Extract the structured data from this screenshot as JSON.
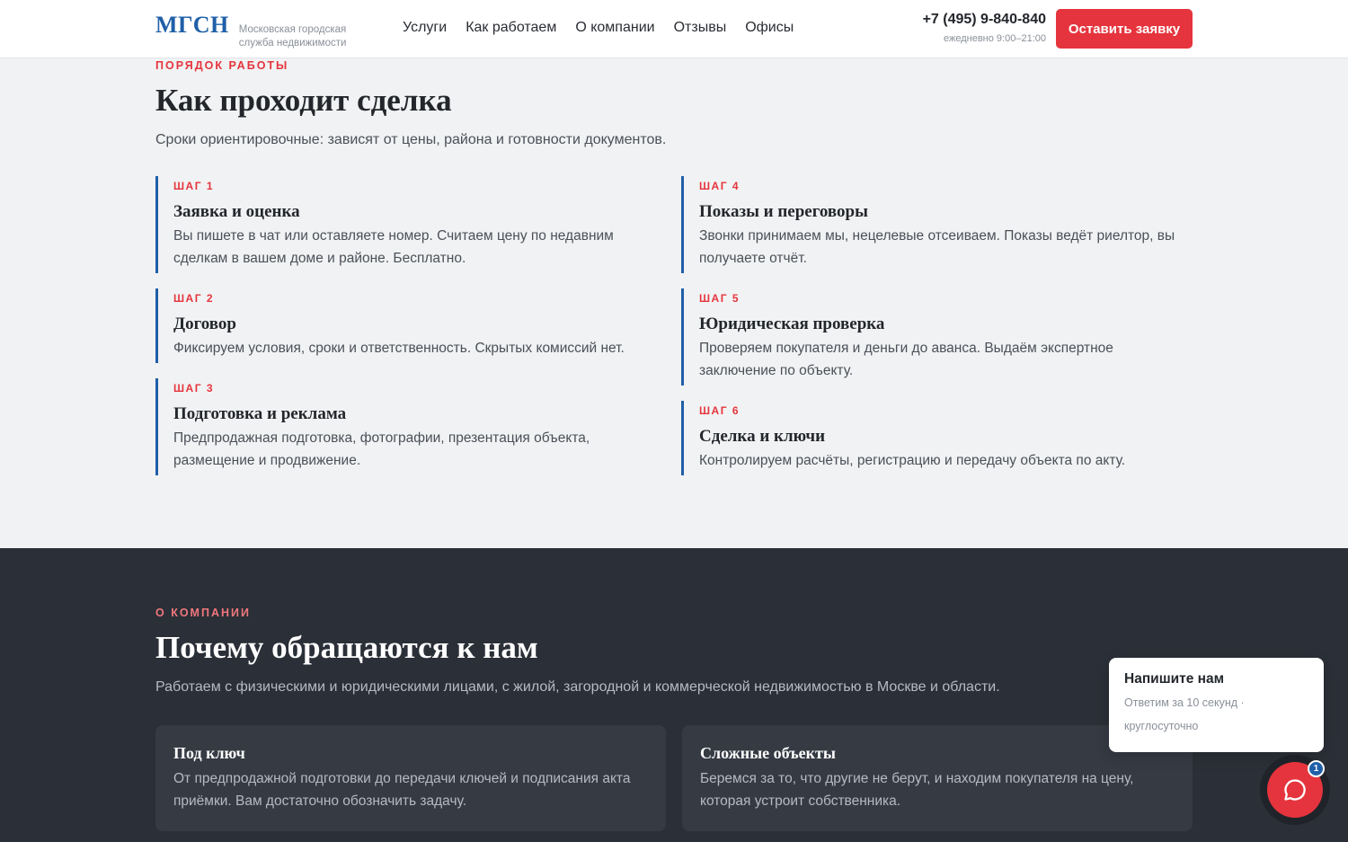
{
  "header": {
    "logo": "МГСН",
    "logo_sub": "Московская городская служба недвижимости",
    "nav": [
      "Услуги",
      "Как работаем",
      "О компании",
      "Отзывы",
      "Офисы"
    ],
    "phone": "+7 (495) 9-840-840",
    "hours": "ежедневно 9:00–21:00",
    "cta_label": "Оставить заявку"
  },
  "steps_section": {
    "eyebrow": "ПОРЯДОК РАБОТЫ",
    "title": "Как проходит сделка",
    "lead": "Сроки ориентировочные: зависят от цены, района и готовности документов.",
    "steps": [
      {
        "num": "ШАГ 1",
        "title": "Заявка и оценка",
        "text": "Вы пишете в чат или оставляете номер. Считаем цену по недавним сделкам в вашем доме и районе. Бесплатно."
      },
      {
        "num": "ШАГ 2",
        "title": "Договор",
        "text": "Фиксируем условия, сроки и ответственность. Скрытых комиссий нет."
      },
      {
        "num": "ШАГ 3",
        "title": "Подготовка и реклама",
        "text": "Предпродажная подготовка, фотографии, презентация объекта, размещение и продвижение."
      },
      {
        "num": "ШАГ 4",
        "title": "Показы и переговоры",
        "text": "Звонки принимаем мы, нецелевые отсеиваем. Показы ведёт риелтор, вы получаете отчёт."
      },
      {
        "num": "ШАГ 5",
        "title": "Юридическая проверка",
        "text": "Проверяем покупателя и деньги до аванса. Выдаём экспертное заключение по объекту."
      },
      {
        "num": "ШАГ 6",
        "title": "Сделка и ключи",
        "text": "Контролируем расчёты, регистрацию и передачу объекта по акту."
      }
    ]
  },
  "about_section": {
    "eyebrow": "О КОМПАНИИ",
    "title": "Почему обращаются к нам",
    "lead": "Работаем с физическими и юридическими лицами, с жилой, загородной и коммерческой недвижимостью в Москве и области.",
    "cards": [
      {
        "title": "Под ключ",
        "text": "От предпродажной подготовки до передачи ключей и подписания акта приёмки. Вам достаточно обозначить задачу."
      },
      {
        "title": "Сложные объекты",
        "text": "Беремся за то, что другие не берут, и находим покупателя на цену, которая устроит собственника."
      }
    ]
  },
  "chat": {
    "title": "Напишите нам",
    "subtitle": "Ответим за 10 секунд · круглосуточно",
    "badge": "1",
    "icon": "chat-bubble-icon"
  },
  "colors": {
    "accent_red": "#e5343d",
    "brand_blue": "#1f5fa8",
    "dark_bg": "#2b2f37"
  }
}
